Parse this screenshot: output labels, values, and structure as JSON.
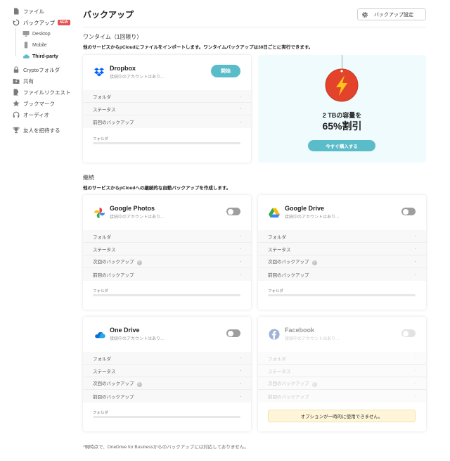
{
  "sidebar": {
    "items": [
      {
        "label": "ファイル"
      },
      {
        "label": "バックアップ",
        "badge": "NEW"
      },
      {
        "label": "Cryptoフォルダ"
      },
      {
        "label": "共有"
      },
      {
        "label": "ファイルリクエスト"
      },
      {
        "label": "ブックマーク"
      },
      {
        "label": "オーディオ"
      },
      {
        "label": "友人を招待する"
      }
    ],
    "sub_items": [
      {
        "label": "Desktop"
      },
      {
        "label": "Mobile"
      },
      {
        "label": "Third-party"
      }
    ]
  },
  "header": {
    "title": "バックアップ",
    "settings_label": "バックアップ設定"
  },
  "onetime": {
    "title": "ワンタイム（1回限り）",
    "desc": "他のサービスからpCloudにファイルをインポートします。ワンタイムバックアップは30日ごとに実行できます。"
  },
  "continuous": {
    "title": "継続",
    "desc": "他のサービスからpCloudへの継続的な自動バックアップを作成します。"
  },
  "labels": {
    "folder": "フォルダ",
    "status": "ステータス",
    "next_backup": "次回のバックアップ",
    "last_backup": "前回のバックアップ",
    "dash": "-",
    "not_connected": "接続中のアカウントはあり...",
    "start": "開始",
    "unavailable": "オプションが一時的に使用できません。"
  },
  "services": {
    "dropbox": {
      "name": "Dropbox"
    },
    "google_photos": {
      "name": "Google Photos"
    },
    "google_drive": {
      "name": "Google Drive"
    },
    "onedrive": {
      "name": "One Drive"
    },
    "facebook": {
      "name": "Facebook"
    }
  },
  "promo": {
    "line1": "2 TBの容量を",
    "line2": "65%割引",
    "button": "今すぐ購入する"
  },
  "footnote": "*現時点で、OneDrive for Businessからのバックアップには対応しておりません。",
  "colors": {
    "accent": "#5bbcc9",
    "badge": "#e64f4f",
    "promo_bg": "#effbfc"
  }
}
